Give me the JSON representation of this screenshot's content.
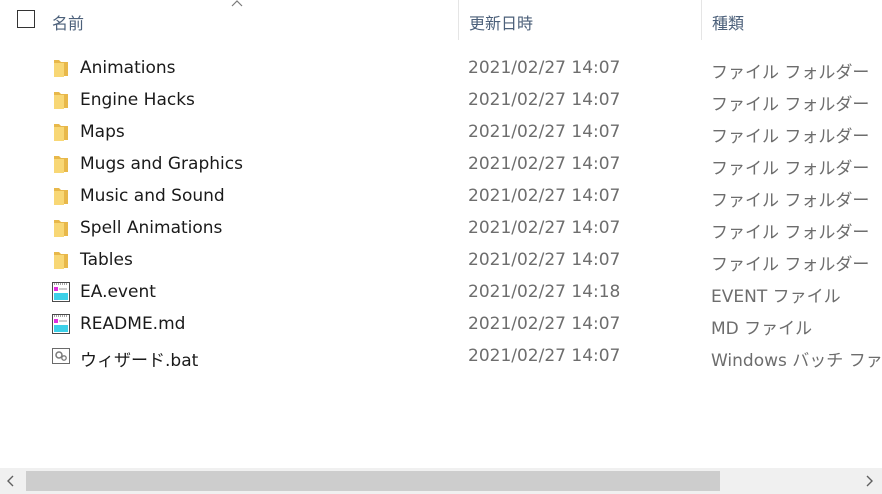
{
  "header": {
    "name_label": "名前",
    "date_label": "更新日時",
    "type_label": "種類"
  },
  "files": [
    {
      "name": "Animations",
      "date": "2021/02/27 14:07",
      "type": "ファイル フォルダー",
      "icon": "folder-icon"
    },
    {
      "name": "Engine Hacks",
      "date": "2021/02/27 14:07",
      "type": "ファイル フォルダー",
      "icon": "folder-icon"
    },
    {
      "name": "Maps",
      "date": "2021/02/27 14:07",
      "type": "ファイル フォルダー",
      "icon": "folder-icon"
    },
    {
      "name": "Mugs and Graphics",
      "date": "2021/02/27 14:07",
      "type": "ファイル フォルダー",
      "icon": "folder-icon"
    },
    {
      "name": "Music and Sound",
      "date": "2021/02/27 14:07",
      "type": "ファイル フォルダー",
      "icon": "folder-icon"
    },
    {
      "name": "Spell Animations",
      "date": "2021/02/27 14:07",
      "type": "ファイル フォルダー",
      "icon": "folder-icon"
    },
    {
      "name": "Tables",
      "date": "2021/02/27 14:07",
      "type": "ファイル フォルダー",
      "icon": "folder-icon"
    },
    {
      "name": "EA.event",
      "date": "2021/02/27 14:18",
      "type": "EVENT ファイル",
      "icon": "text-file-icon"
    },
    {
      "name": "README.md",
      "date": "2021/02/27 14:07",
      "type": "MD ファイル",
      "icon": "text-file-icon"
    },
    {
      "name": "ウィザード.bat",
      "date": "2021/02/27 14:07",
      "type": "Windows バッチ ファイル",
      "icon": "batch-file-icon"
    }
  ],
  "scrollbar": {
    "thumb_fraction": 0.8
  },
  "colors": {
    "folder": "#f8d775",
    "folder_dark": "#e8b84a",
    "header_text": "#4c607a",
    "secondary_text": "#6d6d6d"
  }
}
